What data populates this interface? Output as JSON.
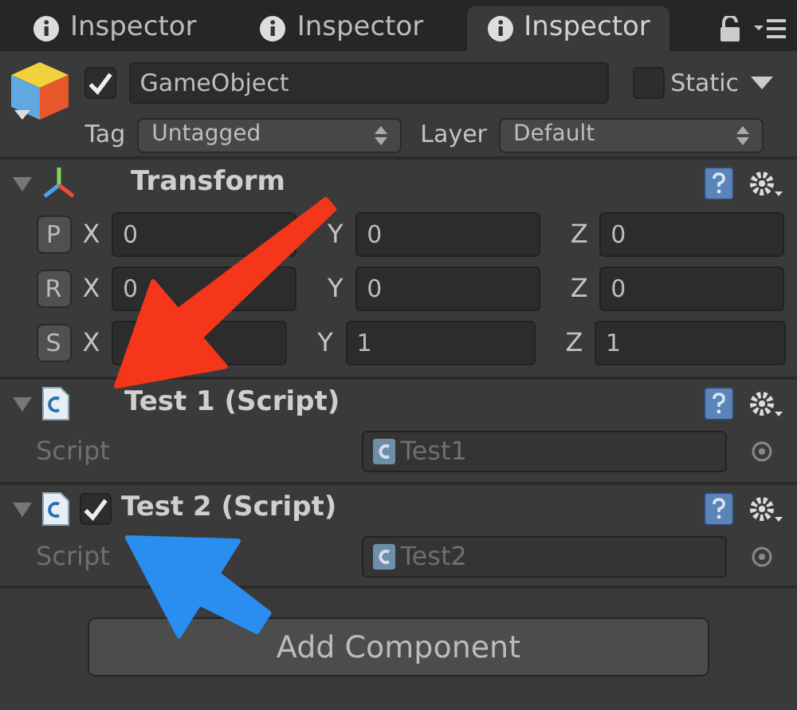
{
  "tabs": [
    {
      "label": "Inspector",
      "selected": false
    },
    {
      "label": "Inspector",
      "selected": false
    },
    {
      "label": "Inspector",
      "selected": true
    }
  ],
  "object": {
    "active": true,
    "name": "GameObject",
    "static_label": "Static",
    "static": false,
    "tag_label": "Tag",
    "tag": "Untagged",
    "layer_label": "Layer",
    "layer": "Default"
  },
  "components": [
    {
      "kind": "transform",
      "title": "Transform",
      "expanded": true,
      "rows": [
        {
          "button": "P",
          "fields": [
            {
              "axis": "X",
              "value": "0"
            },
            {
              "axis": "Y",
              "value": "0"
            },
            {
              "axis": "Z",
              "value": "0"
            }
          ]
        },
        {
          "button": "R",
          "fields": [
            {
              "axis": "X",
              "value": "0"
            },
            {
              "axis": "Y",
              "value": "0"
            },
            {
              "axis": "Z",
              "value": "0"
            }
          ]
        },
        {
          "button": "S",
          "fields": [
            {
              "axis": "X"
            },
            {
              "axis": "Y",
              "value": "1"
            },
            {
              "axis": "Z",
              "value": "1"
            }
          ]
        }
      ]
    },
    {
      "kind": "script",
      "title": "Test 1 (Script)",
      "expanded": true,
      "field_label": "Script",
      "value": "Test1"
    },
    {
      "kind": "script",
      "title": "Test 2 (Script)",
      "expanded": true,
      "enabled": true,
      "field_label": "Script",
      "value": "Test2"
    }
  ],
  "add_button": "Add Component",
  "annotations": [
    {
      "kind": "arrow",
      "color": "#f5361a"
    },
    {
      "kind": "arrow",
      "color": "#2a8ef0"
    }
  ]
}
